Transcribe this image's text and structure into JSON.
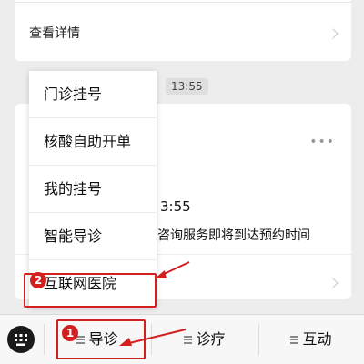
{
  "top_card": {
    "detail_label": "查看详情"
  },
  "timestamp": "13:55",
  "message_card": {
    "time_fragment": "3:55",
    "message_fragment": "咨询服务即将到达预约时间",
    "more_glyph": "•••"
  },
  "menu": {
    "items": [
      {
        "label": "门诊挂号"
      },
      {
        "label": "核酸自助开单"
      },
      {
        "label": "我的挂号"
      },
      {
        "label": "智能导诊"
      },
      {
        "label": "互联网医院"
      }
    ]
  },
  "tabbar": {
    "tabs": [
      {
        "label": "导诊"
      },
      {
        "label": "诊疗"
      },
      {
        "label": "互动"
      }
    ]
  },
  "annotations": {
    "badges": [
      {
        "label": "1"
      },
      {
        "label": "2"
      }
    ],
    "color": "#d41f1f"
  }
}
